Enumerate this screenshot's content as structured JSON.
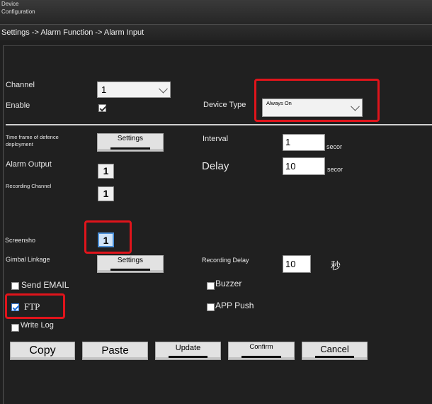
{
  "window": {
    "title": "Device Configuration"
  },
  "breadcrumb": "Settings -> Alarm Function -> Alarm Input",
  "form": {
    "channel": {
      "label": "Channel",
      "value": "1"
    },
    "enable": {
      "label": "Enable",
      "checked": true
    },
    "device_type": {
      "label": "Device Type",
      "value": "Always On"
    },
    "time_frame": {
      "label": "Time frame of defence deployment",
      "button": "Settings"
    },
    "interval": {
      "label": "Interval",
      "value": "1",
      "unit": "secor"
    },
    "alarm_output": {
      "label": "Alarm Output",
      "value": "1"
    },
    "delay": {
      "label": "Delay",
      "value": "10",
      "unit": "secor"
    },
    "recording_channel": {
      "label": "Recording Channel",
      "value": "1"
    },
    "screenshot": {
      "label": "Screensho",
      "value": "1"
    },
    "gimbal_linkage": {
      "label": "Gimbal Linkage",
      "button": "Settings"
    },
    "recording_delay": {
      "label": "Recording Delay",
      "value": "10",
      "unit": "秒"
    },
    "send_email": {
      "label": "Send EMAIL",
      "checked": false
    },
    "buzzer": {
      "label": "Buzzer",
      "checked": false
    },
    "ftp": {
      "label": "FTP",
      "checked": true
    },
    "app_push": {
      "label": "APP Push",
      "checked": false
    },
    "write_log": {
      "label": "Write Log",
      "checked": false
    }
  },
  "actions": {
    "copy": "Copy",
    "paste": "Paste",
    "update": "Update",
    "confirm": "Confirm",
    "cancel": "Cancel"
  },
  "colors": {
    "highlight": "#e0141b",
    "background": "#1f1f1f",
    "check_blue": "#1d6ed8"
  }
}
